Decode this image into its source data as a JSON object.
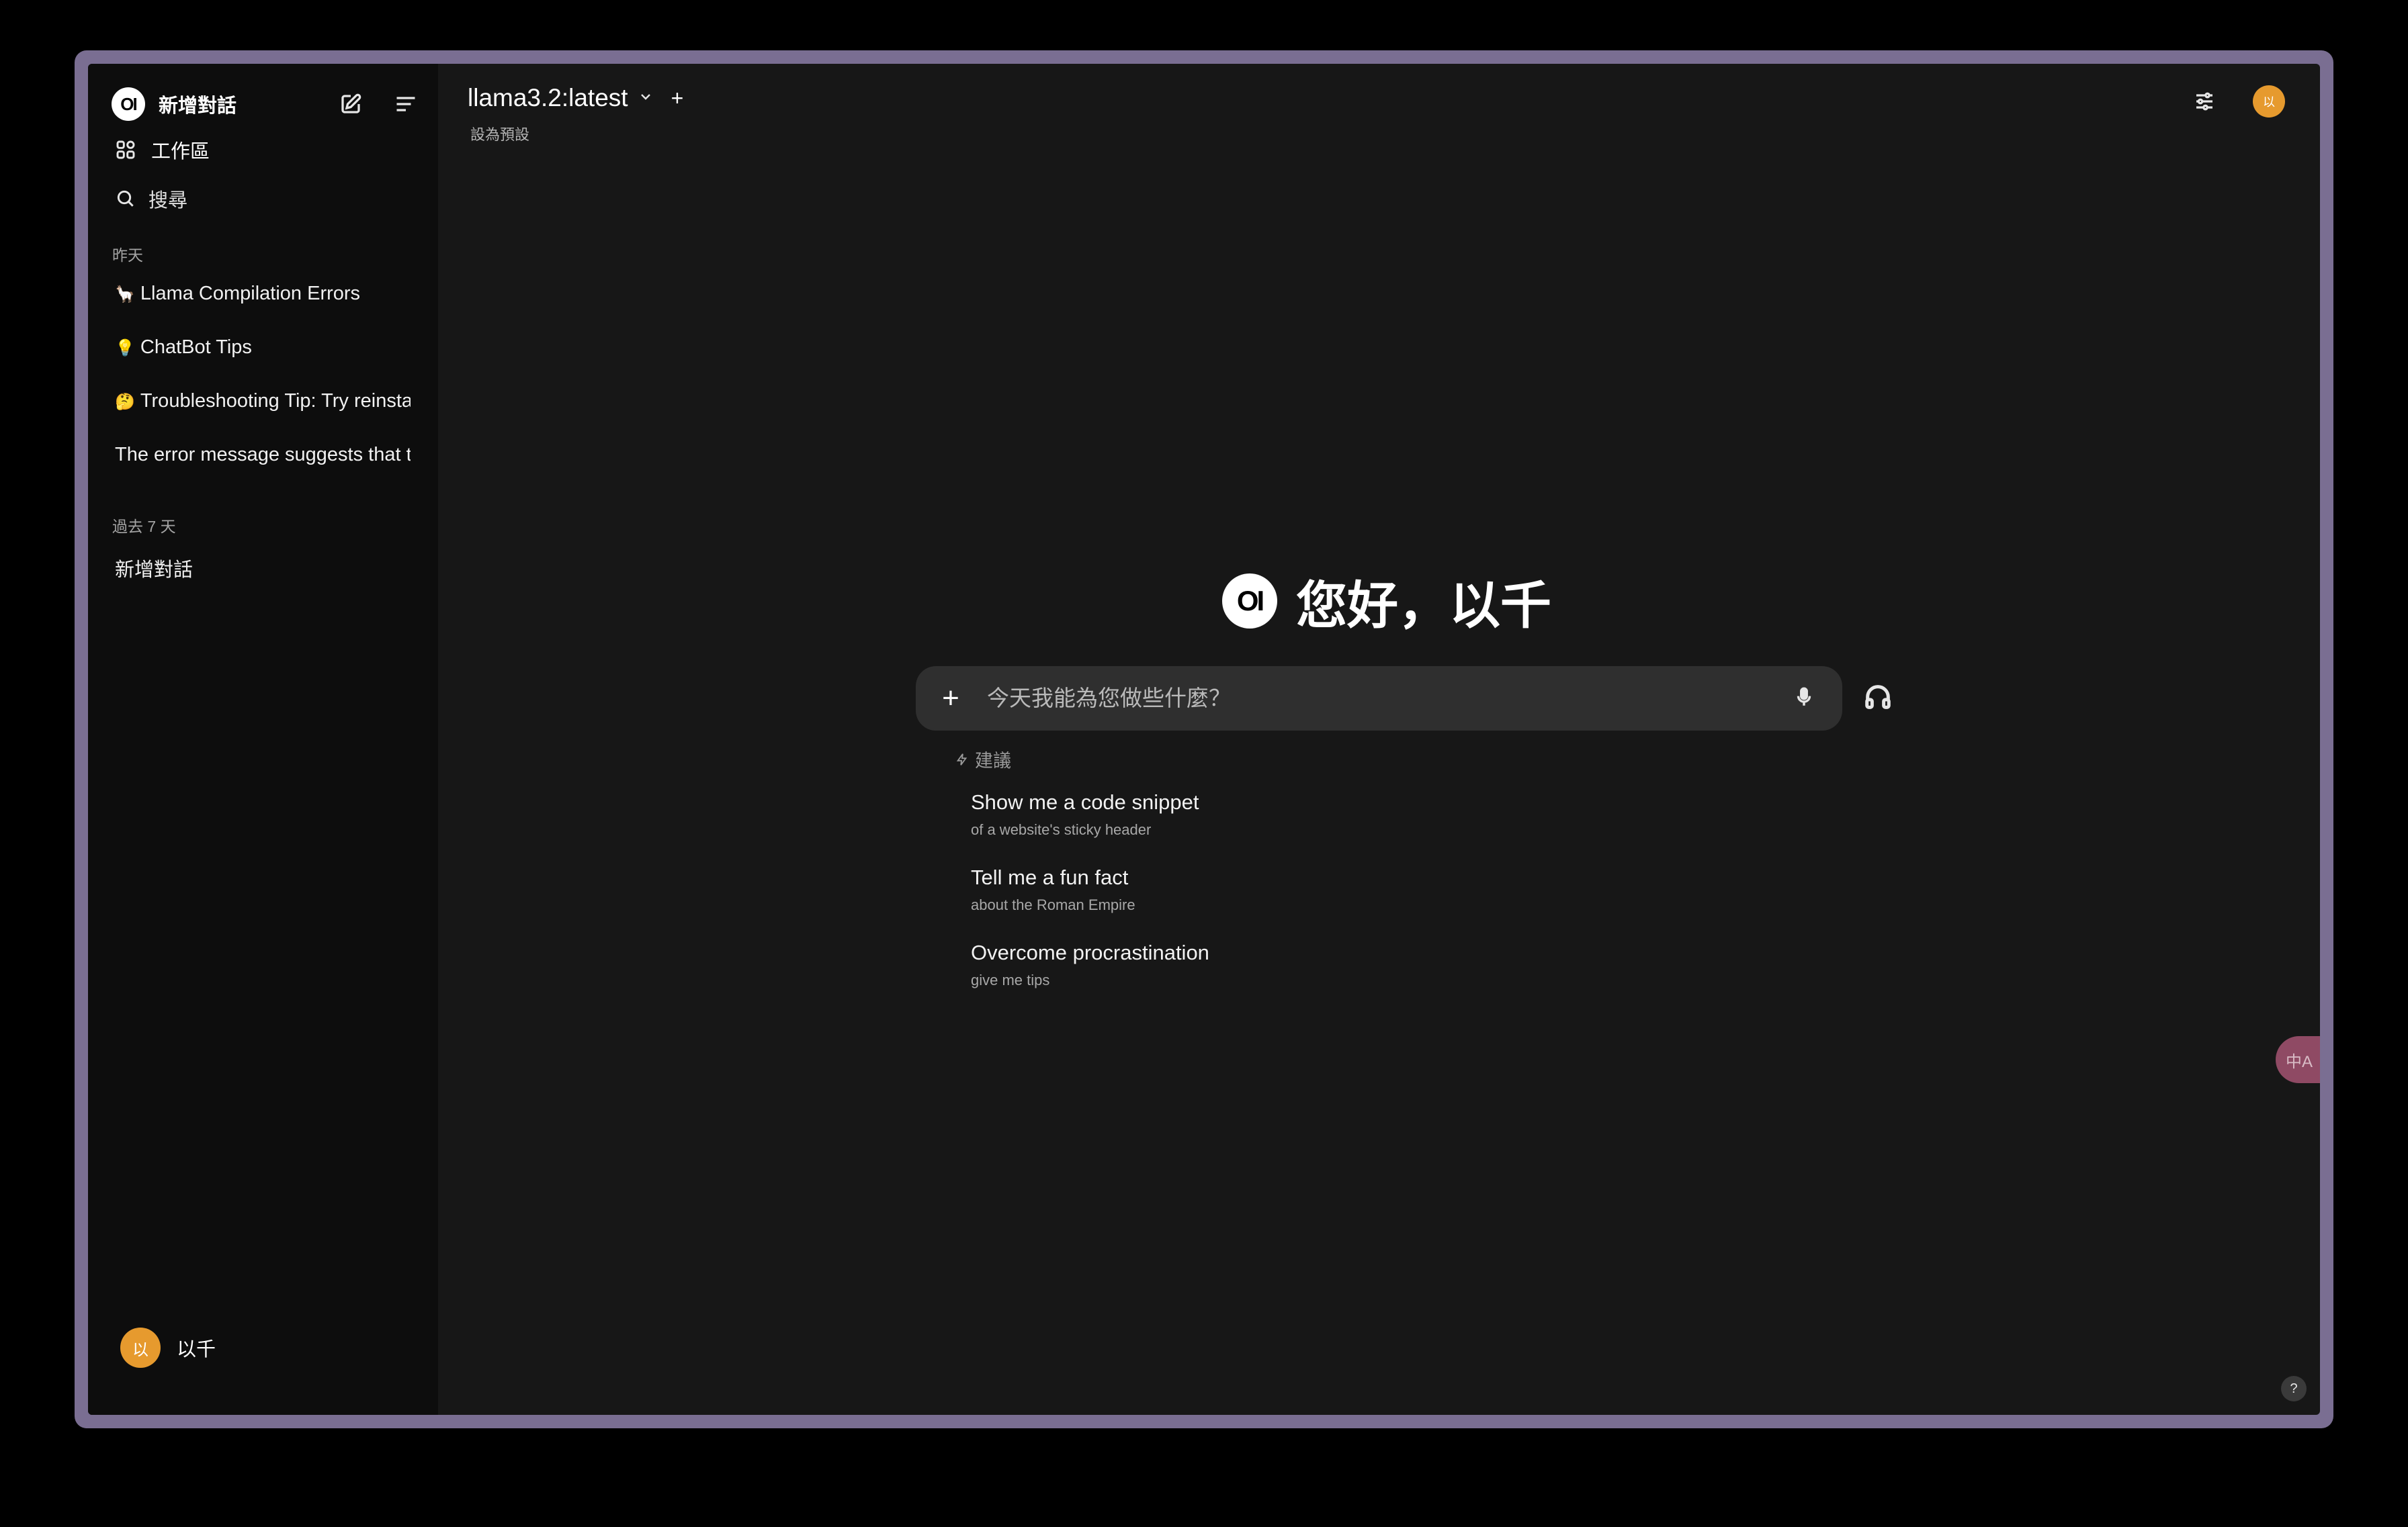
{
  "sidebar": {
    "logo_text": "OI",
    "title": "新增對話",
    "nav": {
      "workspace": "工作區",
      "search": "搜尋"
    },
    "sections": [
      {
        "label": "昨天",
        "items": [
          {
            "emoji": "🦙",
            "label": "Llama Compilation Errors"
          },
          {
            "emoji": "💡",
            "label": "ChatBot Tips"
          },
          {
            "emoji": "🤔",
            "label": "Troubleshooting Tip: Try reinstalling"
          },
          {
            "emoji": "",
            "label": "The error message suggests that the"
          }
        ]
      },
      {
        "label": "過去 7 天",
        "items": [
          {
            "emoji": "",
            "label": "新增對話"
          }
        ]
      }
    ],
    "user": {
      "avatar_text": "以",
      "name": "以千"
    }
  },
  "header": {
    "model_name": "llama3.2:latest",
    "add_symbol": "+",
    "set_default": "設為預設",
    "avatar_text": "以"
  },
  "main": {
    "logo_text": "OI",
    "greeting": "您好，以千",
    "input": {
      "add_symbol": "+",
      "placeholder": "今天我能為您做些什麼？",
      "value": ""
    },
    "suggestions_label": "建議",
    "suggestions": [
      {
        "title": "Show me a code snippet",
        "subtitle": "of a website's sticky header"
      },
      {
        "title": "Tell me a fun fact",
        "subtitle": "about the Roman Empire"
      },
      {
        "title": "Overcome procrastination",
        "subtitle": "give me tips"
      }
    ],
    "translate_fab": "中A",
    "help": "?"
  },
  "colors": {
    "accent_avatar": "#e69a2e",
    "sidebar_bg": "#0d0d0d",
    "main_bg": "#171717",
    "input_bg": "#2f2f2f",
    "frame": "#7a6e92"
  }
}
